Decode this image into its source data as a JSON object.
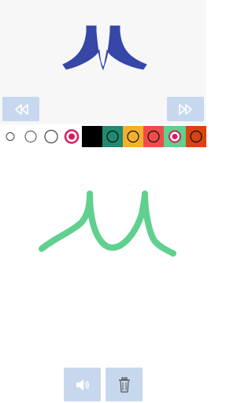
{
  "reference_glyph": {
    "icon": "m-letter-glyph-icon",
    "color": "#3647a8"
  },
  "navigation": {
    "prev_icon": "rewind-icon",
    "next_icon": "fast-forward-icon",
    "button_color": "#c7d8ee",
    "icon_color": "#ffffff"
  },
  "palette": {
    "brush_sizes": [
      {
        "name": "brush-size-1",
        "selected": false
      },
      {
        "name": "brush-size-2",
        "selected": false
      },
      {
        "name": "brush-size-3",
        "selected": false
      },
      {
        "name": "brush-size-4",
        "selected": true
      }
    ],
    "colors": [
      {
        "name": "black",
        "hex": "#000000",
        "selected": false
      },
      {
        "name": "teal",
        "hex": "#1f8a70",
        "selected": false
      },
      {
        "name": "amber",
        "hex": "#f4b02d",
        "selected": false
      },
      {
        "name": "red",
        "hex": "#ef4b4b",
        "selected": false
      },
      {
        "name": "mint-green",
        "hex": "#5fd08e",
        "selected": true
      },
      {
        "name": "orange-red",
        "hex": "#d84310",
        "selected": false
      }
    ],
    "selected_ring_color": "#d81b60"
  },
  "drawing": {
    "stroke_color": "#5fd08e"
  },
  "bottom_bar": {
    "sound_icon": "speaker-icon",
    "trash_icon": "trash-icon",
    "button_color": "#c7d8ee"
  }
}
